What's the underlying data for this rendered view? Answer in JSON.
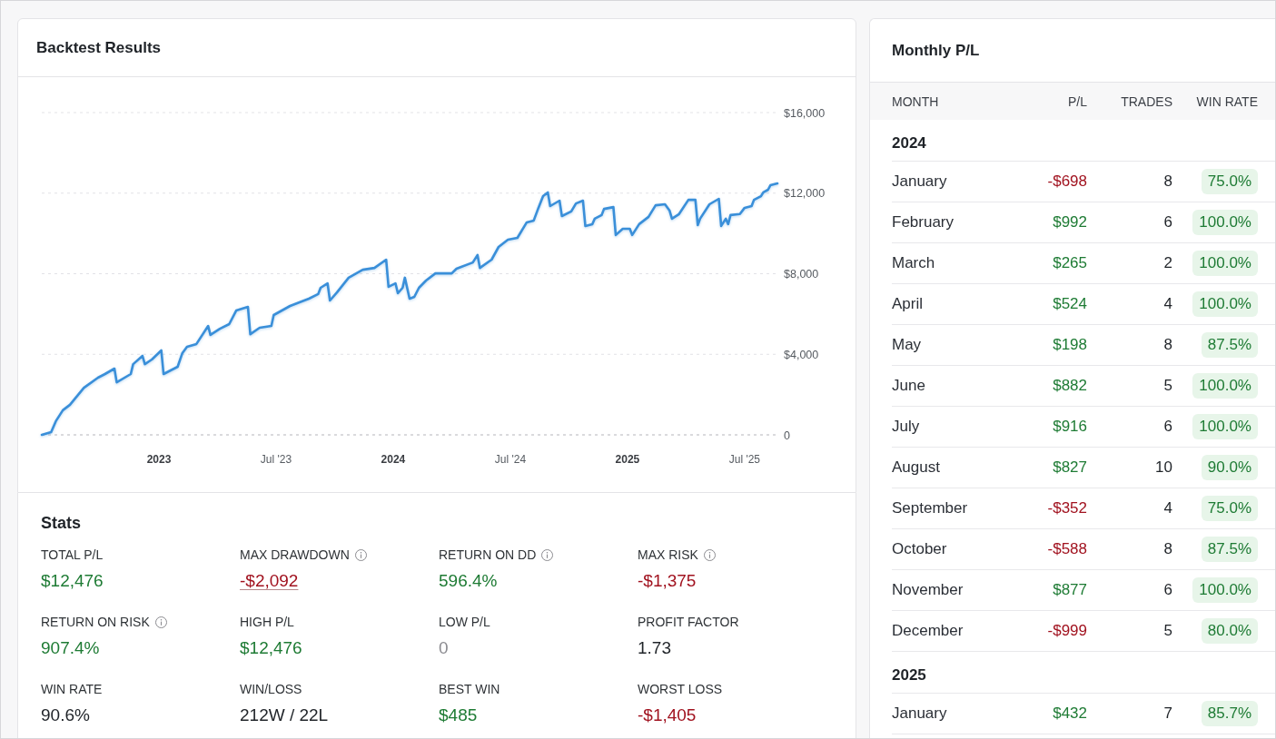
{
  "backtest": {
    "title": "Backtest Results",
    "chart_data": {
      "type": "line",
      "grid": true,
      "xlim": [
        2022.5,
        2025.64
      ],
      "ylim": [
        0,
        16000
      ],
      "xticks": [
        {
          "value": 2023,
          "label": "2023"
        },
        {
          "value": 2023.5,
          "label": "Jul '23"
        },
        {
          "value": 2024,
          "label": "2024"
        },
        {
          "value": 2024.5,
          "label": "Jul '24"
        },
        {
          "value": 2025,
          "label": "2025"
        },
        {
          "value": 2025.5,
          "label": "Jul '25"
        }
      ],
      "yticks": [
        {
          "value": 0,
          "label": "0"
        },
        {
          "value": 4000,
          "label": "$4,000"
        },
        {
          "value": 8000,
          "label": "$8,000"
        },
        {
          "value": 12000,
          "label": "$12,000"
        },
        {
          "value": 16000,
          "label": "$16,000"
        }
      ],
      "x": [
        2022.5,
        2022.54,
        2022.56,
        2022.59,
        2022.62,
        2022.68,
        2022.74,
        2022.77,
        2022.81,
        2022.82,
        2022.88,
        2022.89,
        2022.93,
        2022.94,
        2022.97,
        2023.01,
        2023.02,
        2023.08,
        2023.1,
        2023.12,
        2023.16,
        2023.21,
        2023.22,
        2023.26,
        2023.3,
        2023.33,
        2023.38,
        2023.39,
        2023.43,
        2023.48,
        2023.49,
        2023.56,
        2023.64,
        2023.68,
        2023.69,
        2023.72,
        2023.73,
        2023.76,
        2023.81,
        2023.87,
        2023.92,
        2023.97,
        2023.98,
        2024.01,
        2024.02,
        2024.04,
        2024.05,
        2024.07,
        2024.09,
        2024.11,
        2024.14,
        2024.18,
        2024.25,
        2024.27,
        2024.34,
        2024.36,
        2024.37,
        2024.42,
        2024.45,
        2024.49,
        2024.53,
        2024.57,
        2024.6,
        2024.62,
        2024.64,
        2024.66,
        2024.67,
        2024.71,
        2024.72,
        2024.76,
        2024.78,
        2024.81,
        2024.82,
        2024.85,
        2024.86,
        2024.89,
        2024.9,
        2024.94,
        2024.95,
        2024.98,
        2025.01,
        2025.02,
        2025.05,
        2025.09,
        2025.12,
        2025.16,
        2025.18,
        2025.19,
        2025.22,
        2025.26,
        2025.29,
        2025.3,
        2025.31,
        2025.35,
        2025.39,
        2025.4,
        2025.42,
        2025.43,
        2025.44,
        2025.48,
        2025.5,
        2025.53,
        2025.54,
        2025.57,
        2025.58,
        2025.6,
        2025.61,
        2025.64
      ],
      "series": [
        {
          "color": "#3a8fd9",
          "values": [
            0,
            140,
            680,
            1220,
            1490,
            2340,
            2840,
            3020,
            3290,
            2610,
            3020,
            3510,
            3920,
            3510,
            3740,
            4190,
            3020,
            3380,
            4060,
            4370,
            4510,
            5410,
            4960,
            5270,
            5500,
            6170,
            6350,
            5000,
            5320,
            5410,
            5950,
            6400,
            6760,
            6990,
            7300,
            7520,
            6670,
            7070,
            7800,
            8200,
            8290,
            8700,
            7350,
            7520,
            7030,
            7300,
            7800,
            6760,
            6850,
            7300,
            7660,
            8020,
            8020,
            8250,
            8560,
            8930,
            8290,
            8700,
            9330,
            9690,
            9780,
            10550,
            10640,
            11270,
            11850,
            12040,
            11360,
            11630,
            10860,
            11090,
            11490,
            11630,
            10370,
            10460,
            10730,
            10910,
            11220,
            11310,
            9920,
            10230,
            10230,
            9920,
            10460,
            10820,
            11400,
            11450,
            11130,
            10730,
            10960,
            11670,
            11670,
            10410,
            10730,
            11450,
            11720,
            10370,
            10730,
            10460,
            10910,
            10960,
            11270,
            11360,
            11670,
            11850,
            12040,
            12170,
            12390,
            12480
          ]
        }
      ]
    }
  },
  "stats": {
    "title": "Stats",
    "items": [
      {
        "label": "TOTAL P/L",
        "value": "$12,476",
        "color": "#1e7b34",
        "info": false,
        "underlined": false
      },
      {
        "label": "MAX DRAWDOWN",
        "value": "-$2,092",
        "color": "#a1121f",
        "info": true,
        "underlined": true
      },
      {
        "label": "RETURN ON DD",
        "value": "596.4%",
        "color": "#1e7b34",
        "info": true,
        "underlined": false
      },
      {
        "label": "MAX RISK",
        "value": "-$1,375",
        "color": "#a1121f",
        "info": true,
        "underlined": false
      },
      {
        "label": "RETURN ON RISK",
        "value": "907.4%",
        "color": "#1e7b34",
        "info": true,
        "underlined": false
      },
      {
        "label": "HIGH P/L",
        "value": "$12,476",
        "color": "#1e7b34",
        "info": false,
        "underlined": false
      },
      {
        "label": "LOW P/L",
        "value": "0",
        "color": "#8c8c91",
        "info": false,
        "underlined": false
      },
      {
        "label": "PROFIT FACTOR",
        "value": "1.73",
        "color": "#1f2328",
        "info": false,
        "underlined": false
      },
      {
        "label": "WIN RATE",
        "value": "90.6%",
        "color": "#1f2328",
        "info": false,
        "underlined": false
      },
      {
        "label": "WIN/LOSS",
        "value": "212W / 22L",
        "color": "#1f2328",
        "info": false,
        "underlined": false
      },
      {
        "label": "BEST WIN",
        "value": "$485",
        "color": "#1e7b34",
        "info": false,
        "underlined": false
      },
      {
        "label": "WORST LOSS",
        "value": "-$1,405",
        "color": "#a1121f",
        "info": false,
        "underlined": false
      }
    ]
  },
  "monthly": {
    "title": "Monthly P/L",
    "columns": [
      "MONTH",
      "P/L",
      "TRADES",
      "WIN RATE"
    ],
    "groups": [
      {
        "year": "2024",
        "rows": [
          {
            "month": "January",
            "pl": "-$698",
            "color": "#a1121f",
            "trades": "8",
            "win_rate": "75.0%"
          },
          {
            "month": "February",
            "pl": "$992",
            "color": "#1e7b34",
            "trades": "6",
            "win_rate": "100.0%"
          },
          {
            "month": "March",
            "pl": "$265",
            "color": "#1e7b34",
            "trades": "2",
            "win_rate": "100.0%"
          },
          {
            "month": "April",
            "pl": "$524",
            "color": "#1e7b34",
            "trades": "4",
            "win_rate": "100.0%"
          },
          {
            "month": "May",
            "pl": "$198",
            "color": "#1e7b34",
            "trades": "8",
            "win_rate": "87.5%"
          },
          {
            "month": "June",
            "pl": "$882",
            "color": "#1e7b34",
            "trades": "5",
            "win_rate": "100.0%"
          },
          {
            "month": "July",
            "pl": "$916",
            "color": "#1e7b34",
            "trades": "6",
            "win_rate": "100.0%"
          },
          {
            "month": "August",
            "pl": "$827",
            "color": "#1e7b34",
            "trades": "10",
            "win_rate": "90.0%"
          },
          {
            "month": "September",
            "pl": "-$352",
            "color": "#a1121f",
            "trades": "4",
            "win_rate": "75.0%"
          },
          {
            "month": "October",
            "pl": "-$588",
            "color": "#a1121f",
            "trades": "8",
            "win_rate": "87.5%"
          },
          {
            "month": "November",
            "pl": "$877",
            "color": "#1e7b34",
            "trades": "6",
            "win_rate": "100.0%"
          },
          {
            "month": "December",
            "pl": "-$999",
            "color": "#a1121f",
            "trades": "5",
            "win_rate": "80.0%"
          }
        ]
      },
      {
        "year": "2025",
        "rows": [
          {
            "month": "January",
            "pl": "$432",
            "color": "#1e7b34",
            "trades": "7",
            "win_rate": "85.7%"
          }
        ]
      }
    ]
  }
}
